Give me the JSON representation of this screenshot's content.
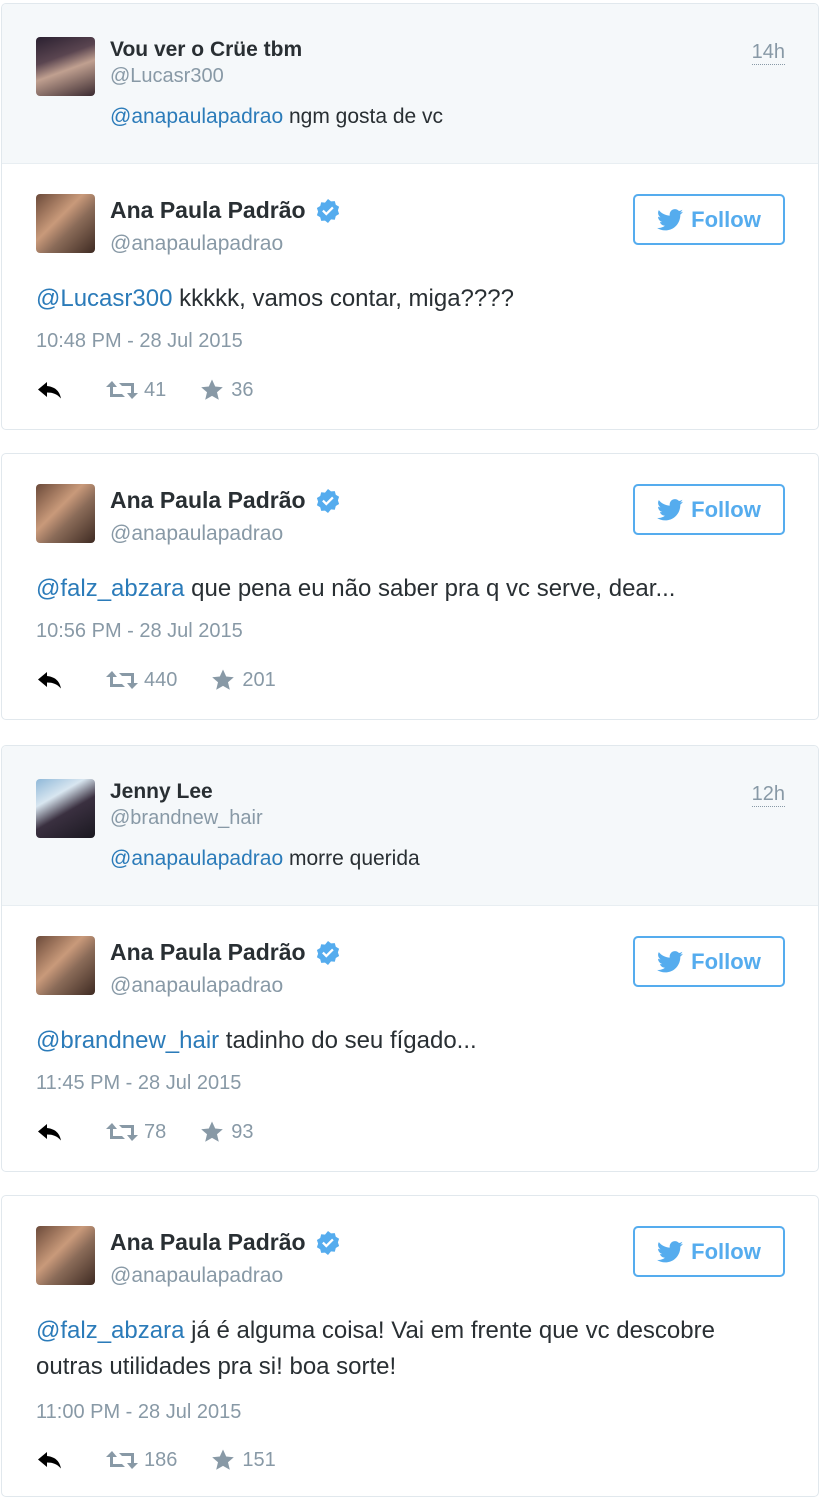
{
  "tweets": [
    {
      "parent": {
        "name": "Vou ver o Crüe tbm",
        "handle": "@Lucasr300",
        "time": "14h",
        "mention": "@anapaulapadrao",
        "text": " ngm gosta de vc"
      },
      "reply": {
        "name": "Ana Paula Padrão",
        "handle": "@anapaulapadrao",
        "follow_label": "Follow",
        "mention": "@Lucasr300",
        "text": " kkkkk, vamos contar, miga????",
        "date": "10:48 PM - 28 Jul 2015",
        "retweets": "41",
        "favorites": "36"
      }
    },
    {
      "reply": {
        "name": "Ana Paula Padrão",
        "handle": "@anapaulapadrao",
        "follow_label": "Follow",
        "mention": "@falz_abzara",
        "text": " que pena eu não saber pra q vc serve, dear...",
        "date": "10:56 PM - 28 Jul 2015",
        "retweets": "440",
        "favorites": "201"
      }
    },
    {
      "parent": {
        "name": "Jenny Lee",
        "handle": "@brandnew_hair",
        "time": "12h",
        "mention": "@anapaulapadrao",
        "text": " morre querida"
      },
      "reply": {
        "name": "Ana Paula Padrão",
        "handle": "@anapaulapadrao",
        "follow_label": "Follow",
        "mention": "@brandnew_hair",
        "text": " tadinho do seu fígado...",
        "date": "11:45 PM - 28 Jul 2015",
        "retweets": "78",
        "favorites": "93"
      }
    },
    {
      "reply": {
        "name": "Ana Paula Padrão",
        "handle": "@anapaulapadrao",
        "follow_label": "Follow",
        "mention": "@falz_abzara",
        "text": " já é alguma coisa! Vai em frente que vc descobre outras utilidades pra si! boa sorte!",
        "date": "11:00 PM - 28 Jul 2015",
        "retweets": "186",
        "favorites": "151"
      }
    }
  ],
  "colors": {
    "link": "#2b7bb9",
    "twitter_blue": "#55acee",
    "muted": "#8899a6",
    "parent_bg": "#f5f8fa"
  },
  "icons": [
    "reply-icon",
    "retweet-icon",
    "favorite-star-icon",
    "verified-badge-icon",
    "twitter-bird-icon"
  ]
}
